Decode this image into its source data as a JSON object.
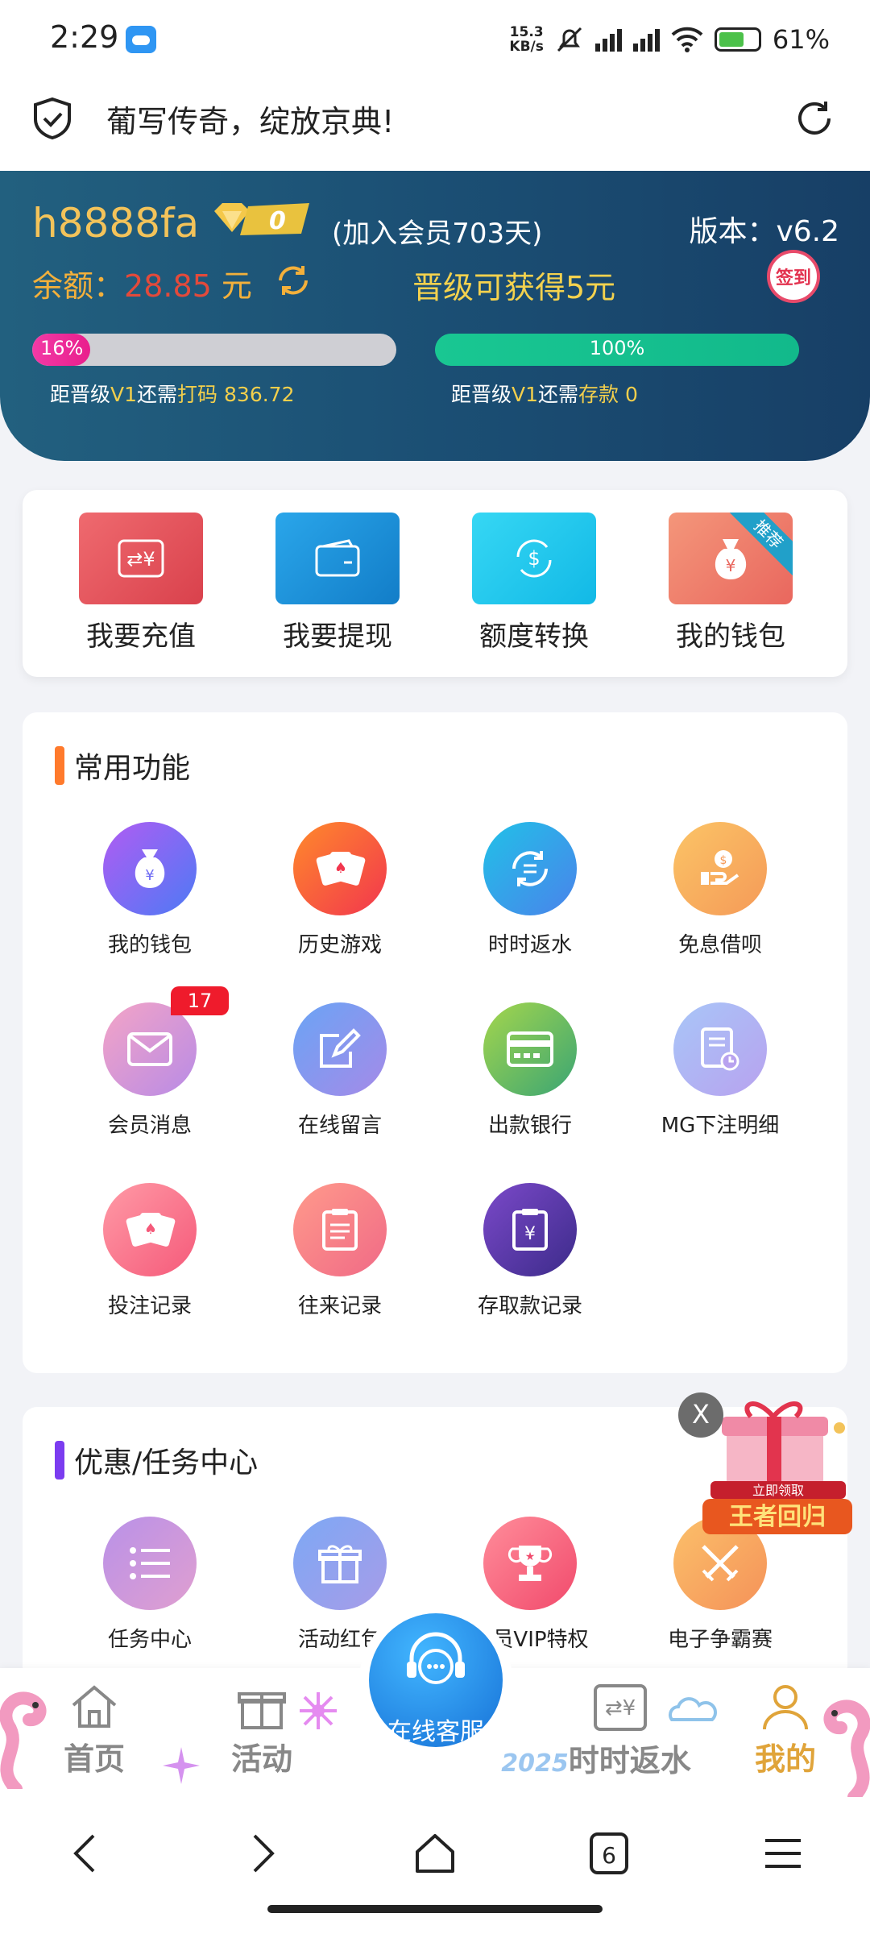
{
  "status_bar": {
    "time": "2:29",
    "speed_value": "15.3",
    "speed_unit": "KB/s",
    "battery": "61%"
  },
  "title_bar": {
    "title": "葡写传奇，绽放京典!"
  },
  "account": {
    "username": "h8888fa",
    "vip_level": "0",
    "joined": "(加入会员703天)",
    "version": "版本：v6.2",
    "balance_label": "余额：",
    "balance_amount": "28.85",
    "balance_unit": "元",
    "upgrade_bonus": "晋级可获得5元",
    "sign_in": "签到",
    "progress_bet": {
      "percent_label": "16%",
      "percent": 16,
      "prefix": "距晋级",
      "level": "V1",
      "middle": "还需",
      "kind": "打码",
      "amount": "836.72"
    },
    "progress_deposit": {
      "percent_label": "100%",
      "percent": 100,
      "prefix": "距晋级",
      "level": "V1",
      "middle": "还需",
      "kind": "存款",
      "amount": "0"
    }
  },
  "quick_actions": [
    {
      "label": "我要充值",
      "icon": "recharge-icon"
    },
    {
      "label": "我要提现",
      "icon": "wallet-card-icon"
    },
    {
      "label": "额度转换",
      "icon": "dollar-exchange-icon"
    },
    {
      "label": "我的钱包",
      "icon": "money-bag-icon",
      "ribbon": "推荐"
    }
  ],
  "common_functions": {
    "title": "常用功能",
    "items": [
      {
        "label": "我的钱包",
        "icon": "money-bag-icon"
      },
      {
        "label": "历史游戏",
        "icon": "playing-cards-icon"
      },
      {
        "label": "时时返水",
        "icon": "refresh-rebate-icon"
      },
      {
        "label": "免息借呗",
        "icon": "coin-hand-icon"
      },
      {
        "label": "会员消息",
        "icon": "mail-icon",
        "badge": "17"
      },
      {
        "label": "在线留言",
        "icon": "edit-note-icon"
      },
      {
        "label": "出款银行",
        "icon": "bank-card-icon"
      },
      {
        "label": "MG下注明细",
        "icon": "document-clock-icon"
      },
      {
        "label": "投注记录",
        "icon": "playing-cards-icon"
      },
      {
        "label": "往来记录",
        "icon": "clipboard-list-icon"
      },
      {
        "label": "存取款记录",
        "icon": "clipboard-yen-icon"
      }
    ]
  },
  "promo_center": {
    "title": "优惠/任务中心",
    "items": [
      {
        "label": "任务中心",
        "icon": "list-icon"
      },
      {
        "label": "活动红包",
        "icon": "gift-icon"
      },
      {
        "label": "会员VIP特权",
        "icon": "trophy-icon"
      },
      {
        "label": "电子争霸赛",
        "icon": "crossed-swords-icon"
      }
    ]
  },
  "floating_promo": {
    "close": "X",
    "top_line": "立即领取",
    "headline": "王者回归"
  },
  "bottom_nav": {
    "home": "首页",
    "activity": "活动",
    "support": "在线客服",
    "rebate": "时时返水",
    "rebate_tag": "2025",
    "mine": "我的"
  },
  "system_nav": {
    "tabs_count": "6"
  },
  "colors": {
    "header_blue": "#1b4f74",
    "gold": "#f3c35a",
    "balance_red": "#e34a3b",
    "progress_pink": "#e91e8c",
    "progress_green": "#1cc491"
  }
}
